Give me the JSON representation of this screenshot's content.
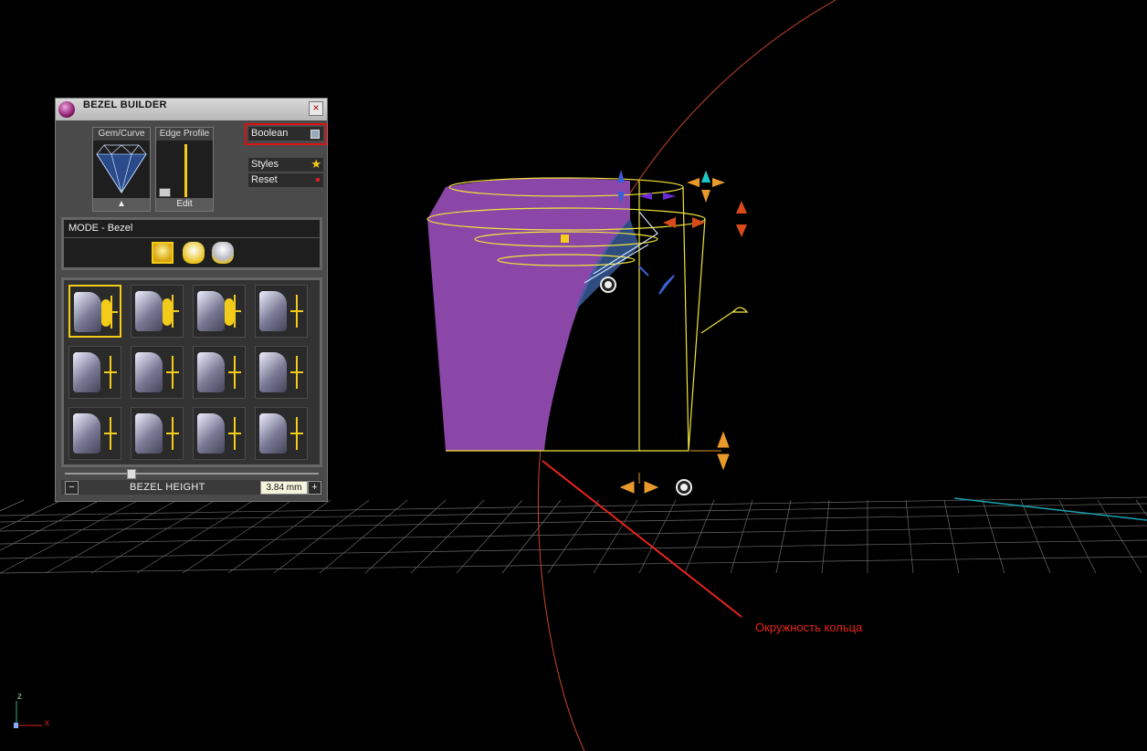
{
  "window": {
    "title": "BEZEL BUILDER",
    "close_glyph": "×"
  },
  "tiles": {
    "gem_curve": {
      "label": "Gem/Curve",
      "foot_glyph": "▲"
    },
    "edge_profile": {
      "label": "Edge Profile",
      "foot": "Edit"
    }
  },
  "side_buttons": {
    "boolean": "Boolean",
    "styles": "Styles",
    "reset": "Reset"
  },
  "mode": {
    "title": "MODE - Bezel"
  },
  "bezel_height": {
    "minus": "−",
    "label": "BEZEL HEIGHT",
    "value": "3.84 mm",
    "plus": "+"
  },
  "annotation": "Окружность кольца",
  "axes": {
    "z": "z",
    "x": "x"
  },
  "colors": {
    "gold": "#f3cc1a",
    "purple": "#8a47a8",
    "red_note": "#e8241a"
  },
  "icons": [
    "app-logo-icon",
    "close-icon",
    "gem-icon",
    "folder-icon",
    "toggle-icon",
    "star-icon",
    "reset-icon",
    "mode-bezel-icon"
  ]
}
